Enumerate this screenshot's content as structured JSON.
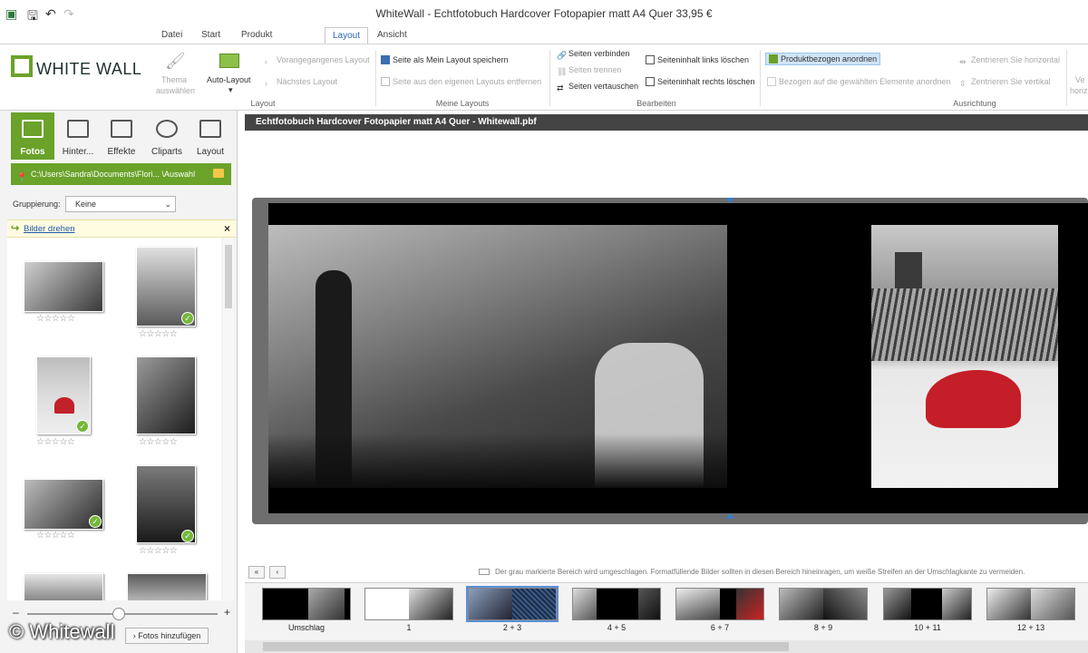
{
  "window": {
    "title": "WhiteWall - Echtfotobuch Hardcover Fotopapier matt A4 Quer 33,95 €"
  },
  "quick_access": [
    "app-icon",
    "save-icon",
    "undo-icon",
    "redo-icon"
  ],
  "ribbon": {
    "tabs": [
      "Datei",
      "Start",
      "Produkt bearbeiten",
      "Layout",
      "Ansicht"
    ],
    "active_tab": "Layout",
    "logo_text": "WHITE WALL",
    "groups": {
      "layout": {
        "label": "Layout",
        "thema": "Thema",
        "thema2": "auswählen",
        "auto_layout": "Auto-Layout",
        "vorangegangenes": "Vorangegangenes Layout",
        "naechstes": "Nächstes Layout"
      },
      "meine_layouts": {
        "label": "Meine Layouts",
        "speichern": "Seite als Mein Layout speichern",
        "entfernen": "Seite aus den eigenen Layouts entfernen"
      },
      "bearbeiten": {
        "label": "Bearbeiten",
        "verbinden": "Seiten verbinden",
        "trennen": "Seiten trennen",
        "vertauschen": "Seiten vertauschen",
        "links_loeschen": "Seiteninhalt links löschen",
        "rechts_loeschen": "Seiteninhalt rechts löschen"
      },
      "ausrichtung": {
        "label": "Ausrichtung",
        "produktbezogen": "Produktbezogen anordnen",
        "bezogen": "Bezogen auf die gewählten Elemente anordnen",
        "horizontal": "Zentrieren Sie horizontal",
        "vertikal": "Zentrieren Sie vertikal",
        "cut1": "Ve",
        "cut2": "horiz"
      }
    }
  },
  "left_panel": {
    "tabs": [
      "Fotos",
      "Hinter...",
      "Effekte",
      "Cliparts",
      "Layout"
    ],
    "active_tab": "Fotos",
    "path": "C:\\Users\\Sandra\\Documents\\Flori... \\Auswahl",
    "grouping_label": "Gruppierung:",
    "grouping_value": "Keine",
    "hint_link": "Bilder drehen",
    "stars": "☆☆☆☆☆",
    "add_button": "Fotos hinzufügen",
    "zoom_minus": "–",
    "zoom_plus": "+",
    "thumbnail_zoom": 0.5,
    "thumbnails": [
      {
        "used": false
      },
      {
        "used": true
      },
      {
        "used": true
      },
      {
        "used": false
      },
      {
        "used": true
      },
      {
        "used": true
      },
      {
        "used": false
      },
      {
        "used": false
      }
    ]
  },
  "document": {
    "title": "Echtfotobuch Hardcover Fotopapier matt A4 Quer - Whitewall.pbf",
    "info_text": "Der grau markierte Bereich wird umgeschlagen. Formatfüllende Bilder sollten in diesen Bereich hineinragen, um weiße Streifen an der Umschlagkante zu vermeiden."
  },
  "nav": {
    "first": "«",
    "prev": "‹"
  },
  "pages": [
    "Umschlag",
    "1",
    "2 + 3",
    "4 + 5",
    "6 + 7",
    "8 + 9",
    "10 + 11",
    "12 + 13"
  ],
  "selected_page": "2 + 3",
  "watermark": "© Whitewall",
  "colors": {
    "accent_green": "#6aa22a",
    "highlight_blue": "#cfe4f7",
    "link_blue": "#1e5aa8"
  }
}
